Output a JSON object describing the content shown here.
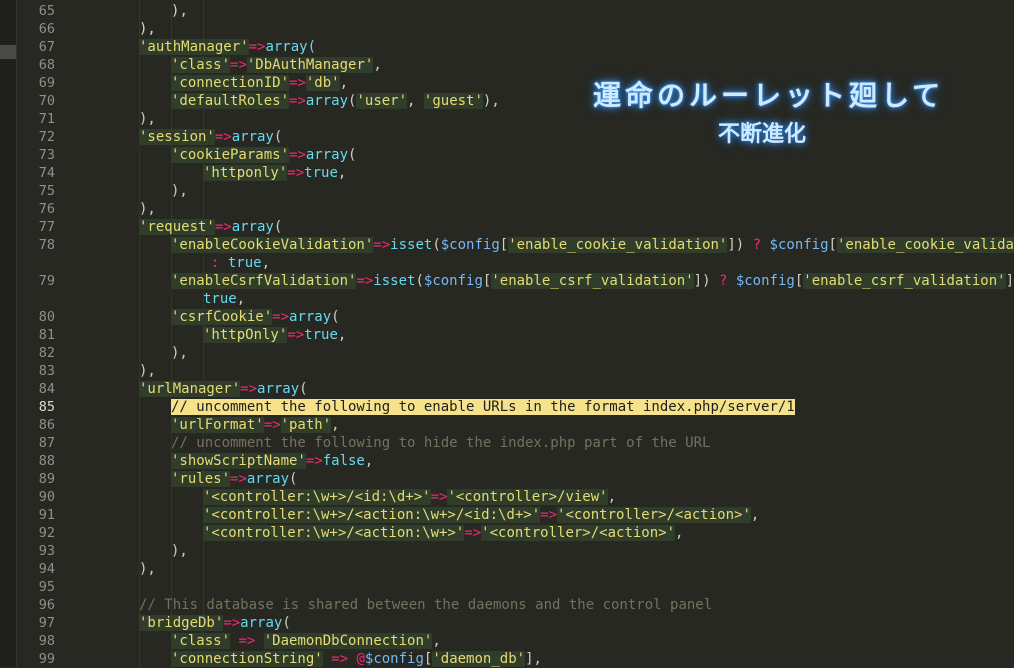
{
  "overlay": {
    "line1": "運命のルーレット廻して",
    "line2": "不断進化"
  },
  "line_numbers": [
    "65",
    "66",
    "67",
    "68",
    "69",
    "70",
    "71",
    "72",
    "73",
    "74",
    "75",
    "76",
    "77",
    "78",
    "",
    "79",
    "",
    "80",
    "81",
    "82",
    "83",
    "84",
    "85",
    "86",
    "87",
    "88",
    "89",
    "90",
    "91",
    "92",
    "93",
    "94",
    "95",
    "96",
    "97",
    "98",
    "99"
  ],
  "active_line": "85",
  "code": {
    "l65": ")",
    "l66": "),",
    "l67_key": "'authManager'",
    "l67_rest": "array(",
    "l68_key": "'class'",
    "l68_val": "'DbAuthManager'",
    "l69_key": "'connectionID'",
    "l69_val": "'db'",
    "l70_key": "'defaultRoles'",
    "l70_v1": "'user'",
    "l70_v2": "'guest'",
    "l72_key": "'session'",
    "l73_key": "'cookieParams'",
    "l74_key": "'httponly'",
    "l77_key": "'request'",
    "l78_key": "'enableCookieValidation'",
    "l78_cfg": "$config",
    "l78_idx": "'enable_cookie_validation'",
    "l79_key": "'enableCsrfValidation'",
    "l79_idx": "'enable_csrf_validation'",
    "l80_key": "'csrfCookie'",
    "l81_key": "'httpOnly'",
    "l84_key": "'urlManager'",
    "l85_comment": "// uncomment the following to enable URLs in the format index.php/server/1",
    "l86_key": "'urlFormat'",
    "l86_val": "'path'",
    "l87_comment": "// uncomment the following to hide the index.php part of the URL",
    "l88_key": "'showScriptName'",
    "l89_key": "'rules'",
    "l90_k": "'<controller:\\w+>/<id:\\d+>'",
    "l90_v": "'<controller>/view'",
    "l91_k": "'<controller:\\w+>/<action:\\w+>/<id:\\d+>'",
    "l91_v": "'<controller>/<action>'",
    "l92_k": "'<controller:\\w+>/<action:\\w+>'",
    "l92_v": "'<controller>/<action>'",
    "l96_comment": "// This database is shared between the daemons and the control panel",
    "l97_key": "'bridgeDb'",
    "l98_key": "'class'",
    "l98_val": "'DaemonDbConnection'",
    "l99_key": "'connectionString'",
    "l99_idx": "'daemon_db'",
    "true": "true",
    "false": "false",
    "array": "array",
    "isset": "isset"
  }
}
